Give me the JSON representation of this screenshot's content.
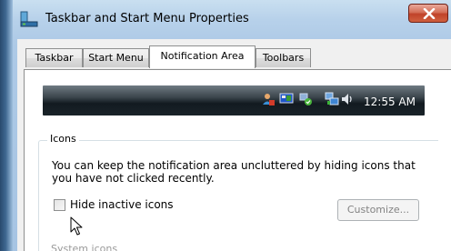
{
  "window": {
    "title": "Taskbar and Start Menu Properties",
    "close_label": "Close"
  },
  "tabs": [
    {
      "label": "Taskbar",
      "active": false
    },
    {
      "label": "Start Menu",
      "active": false
    },
    {
      "label": "Notification Area",
      "active": true
    },
    {
      "label": "Toolbars",
      "active": false
    }
  ],
  "preview": {
    "tray_icons": [
      "network-user-icon",
      "display-icon",
      "network-check-icon",
      "network-computers-icon",
      "speaker-icon"
    ],
    "clock": "12:55 AM"
  },
  "icons_group": {
    "label": "Icons",
    "description": "You can keep the notification area uncluttered by hiding icons that you have not clicked recently.",
    "hide_inactive_label": "Hide inactive icons",
    "hide_inactive_checked": false,
    "customize_label": "Customize..."
  },
  "next_group": {
    "label": "System icons"
  },
  "colors": {
    "title_bar": "#adc9e6",
    "close_button": "#c0432a",
    "taskbar": "#1a2329"
  }
}
